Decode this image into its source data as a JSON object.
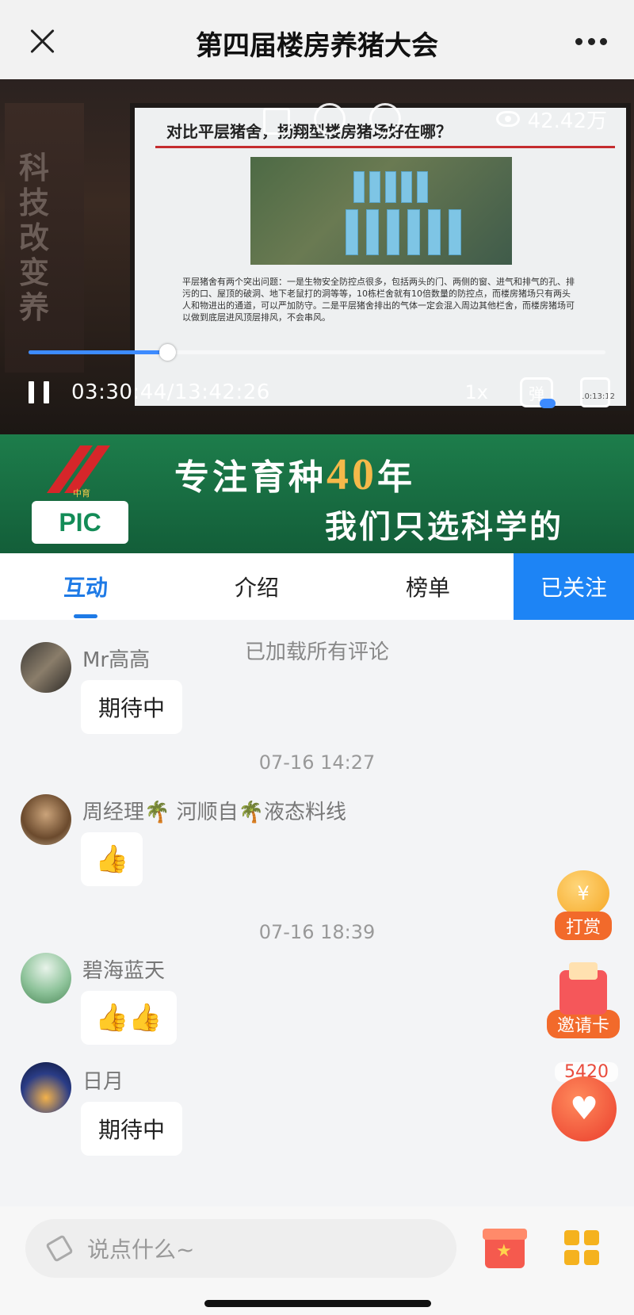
{
  "header": {
    "title": "第四届楼房养猪大会"
  },
  "video": {
    "side_banner_text": "科技改变养",
    "slide_title": "对比平层猪舍，扬翔型楼房猪场好在哪？",
    "slide_text": "平层猪舍有两个突出问题：一是生物安全防控点很多，包括两头的门、两侧的窗、进气和排气的孔、排污的口、屋顶的破洞、地下老鼠打的洞等等，10栋栏舍就有10倍数量的防控点，而楼房猪场只有两头人和物进出的通道，可以严加防守。二是平层猪舍排出的气体一定会混入周边其他栏舍，而楼房猪场可以做到底层进风顶层排风，不会串风。",
    "slide_time": "10:13:12",
    "views": "42.42万",
    "current_time": "03:30:44",
    "separator": "/",
    "total_time": "13:42:26",
    "progress": 0.24,
    "speed": "1x",
    "danmaku_label": "弹"
  },
  "ad": {
    "logo_caption": "中育",
    "logo_text": "PIC",
    "line1_prefix": "专注育种",
    "line1_number": "40",
    "line1_suffix": "年",
    "line2": "我们只选科学的"
  },
  "tabs": [
    {
      "label": "互动"
    },
    {
      "label": "介绍"
    },
    {
      "label": "榜单"
    }
  ],
  "follow_label": "已关注",
  "comments": {
    "loaded_text": "已加载所有评论",
    "items": [
      {
        "user": "Mr高高",
        "message": "期待中"
      },
      {
        "timestamp": "07-16 14:27",
        "user": "周经理🌴 河顺自🌴液态料线",
        "message": "👍"
      },
      {
        "timestamp": "07-16 18:39",
        "user": "碧海蓝天",
        "message": "👍👍"
      },
      {
        "user": "日月",
        "message": "期待中"
      }
    ]
  },
  "floating": {
    "tip_label": "打赏",
    "coin_symbol": "¥",
    "invite_label": "邀请卡",
    "likes": "5420"
  },
  "bottom": {
    "placeholder": "说点什么~"
  },
  "colors": {
    "accent": "#1e7ae6",
    "follow_bg": "#1d84f5",
    "ad_green": "#1d7d4b"
  }
}
